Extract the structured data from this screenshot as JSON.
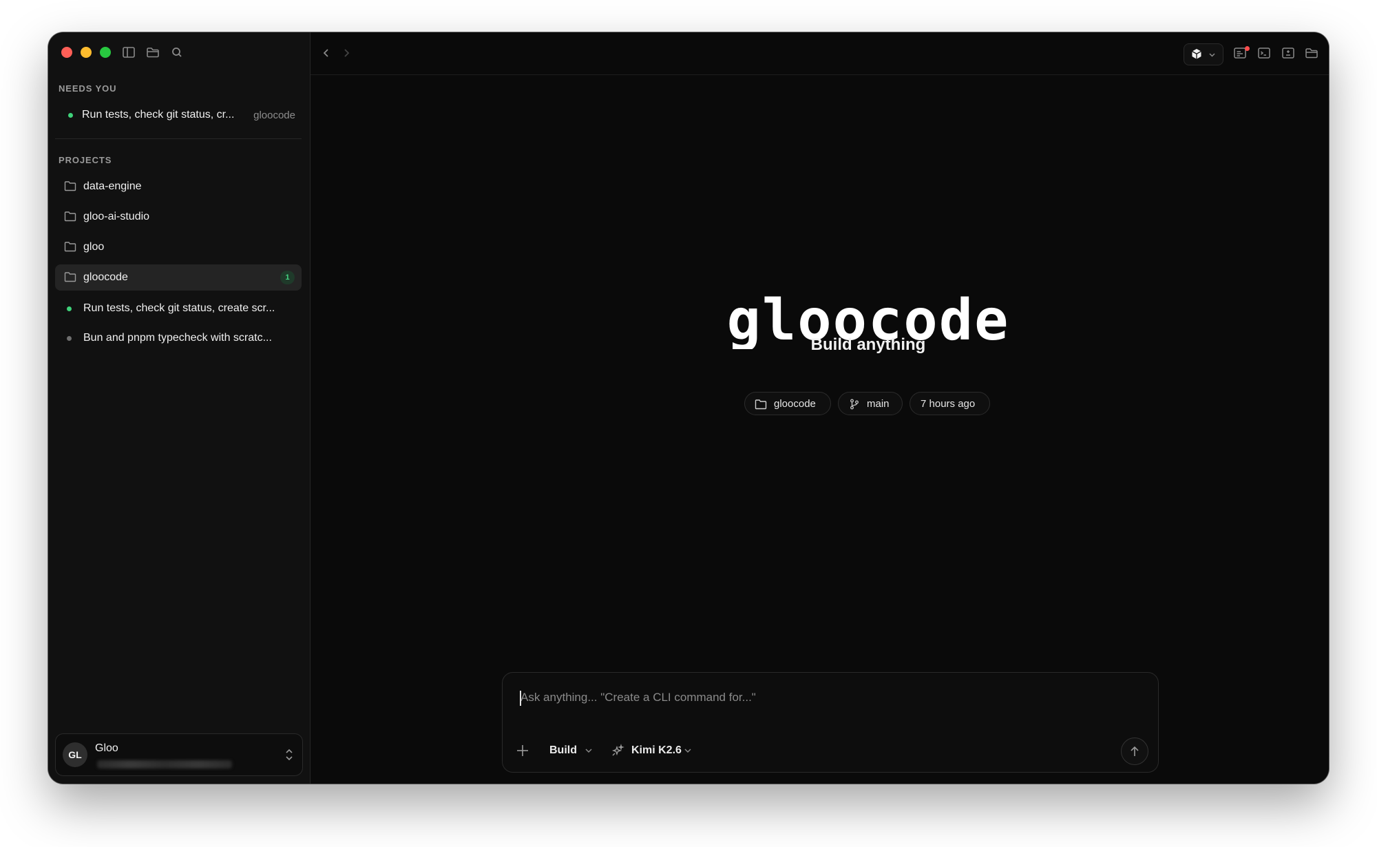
{
  "sidebar": {
    "needs_you_label": "NEEDS YOU",
    "needs_you_items": [
      {
        "title": "Run tests, check git status, cr...",
        "project": "gloocode",
        "status": "active"
      }
    ],
    "projects_label": "PROJECTS",
    "projects": [
      {
        "name": "data-engine"
      },
      {
        "name": "gloo-ai-studio"
      },
      {
        "name": "gloo"
      },
      {
        "name": "gloocode",
        "badge": "1",
        "selected": true
      }
    ],
    "sessions": [
      {
        "title": "Run tests, check git status, create scr...",
        "status": "active"
      },
      {
        "title": "Bun and pnpm typecheck with scratc...",
        "status": "idle"
      }
    ],
    "user": {
      "initials": "GL",
      "name": "Gloo"
    }
  },
  "main": {
    "logo_text": "gloocode",
    "title": "Build anything",
    "chips": [
      {
        "icon": "folder-icon",
        "label": "gloocode"
      },
      {
        "icon": "git-branch-icon",
        "label": "main"
      },
      {
        "icon": "",
        "label": "7 hours ago"
      }
    ],
    "composer": {
      "placeholder": "Ask anything... \"Create a CLI command for...\"",
      "value": "",
      "mode": "Build",
      "model": "Kimi K2.6"
    }
  },
  "colors": {
    "window_bg": "#0a0a0a",
    "sidebar_bg": "#111111",
    "active_dot": "#3fd27a",
    "badge_text": "#45d683",
    "close": "#ff5f57",
    "minimize": "#febc2e",
    "maximize": "#28c840"
  }
}
